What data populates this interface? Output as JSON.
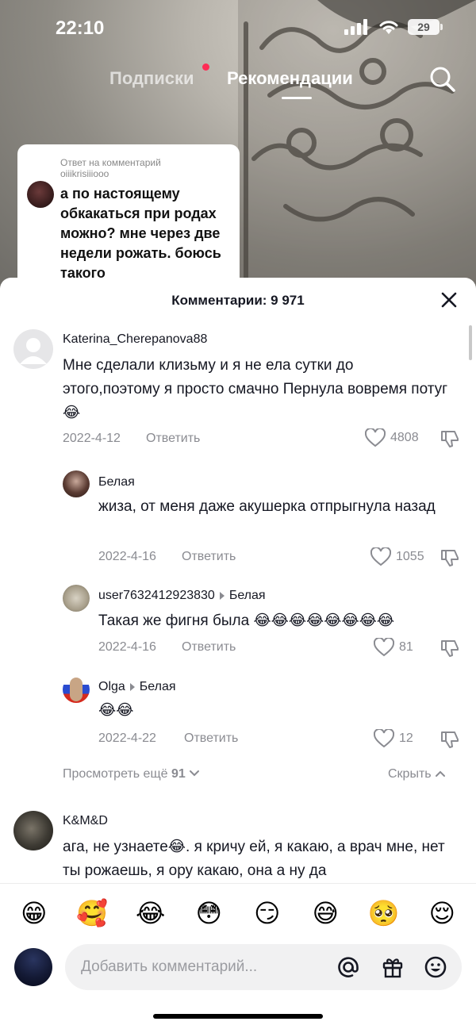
{
  "status_bar": {
    "time": "22:10",
    "battery": "29"
  },
  "top_nav": {
    "tabs": [
      {
        "label": "Подписки"
      },
      {
        "label": "Рекомендации"
      }
    ],
    "search_icon": "search-icon"
  },
  "reply_card": {
    "caption": "Ответ на комментарий",
    "username": "oiiikrisiiiooo",
    "text": "а по настоящему обкакаться при родах можно? мне через две недели рожать. боюсь такого"
  },
  "comments_sheet": {
    "title": "Комментарии: 9 971",
    "close_icon": "close-icon",
    "comments": [
      {
        "username": "Katerina_Cherepanova88",
        "text": "Мне сделали клизьму и я не ела сутки до этого,поэтому я просто смачно Пернула вовремя потуг😂",
        "date": "2022-4-12",
        "reply_label": "Ответить",
        "likes": "4808",
        "replies": [
          {
            "username": "Белая",
            "reply_to": "",
            "text": "жиза, от меня даже акушерка отпрыгнула назад",
            "date": "2022-4-16",
            "reply_label": "Ответить",
            "likes": "1055"
          },
          {
            "username": "user7632412923830",
            "reply_to": "Белая",
            "text": "Такая же фигня была 😂😂😂😂😂😂😂😂",
            "date": "2022-4-16",
            "reply_label": "Ответить",
            "likes": "81"
          },
          {
            "username": "Olga",
            "reply_to": "Белая",
            "text": "😂😂",
            "date": "2022-4-22",
            "reply_label": "Ответить",
            "likes": "12"
          }
        ],
        "view_more_label": "Просмотреть ещё",
        "view_more_count": "91",
        "hide_label": "Скрыть"
      },
      {
        "username": "K&M&D",
        "text": "ага, не узнаете😂. я кричу ей, я какаю, а врач мне, нет ты рожаешь, я ору какаю, она а ну да"
      }
    ]
  },
  "emoji_bar": [
    "😁",
    "🥰",
    "😂",
    "😳",
    "😏",
    "😅",
    "🥺",
    "😌"
  ],
  "comment_input": {
    "placeholder": "Добавить комментарий...",
    "icons": [
      "at-icon",
      "gift-icon",
      "emoji-icon"
    ]
  }
}
